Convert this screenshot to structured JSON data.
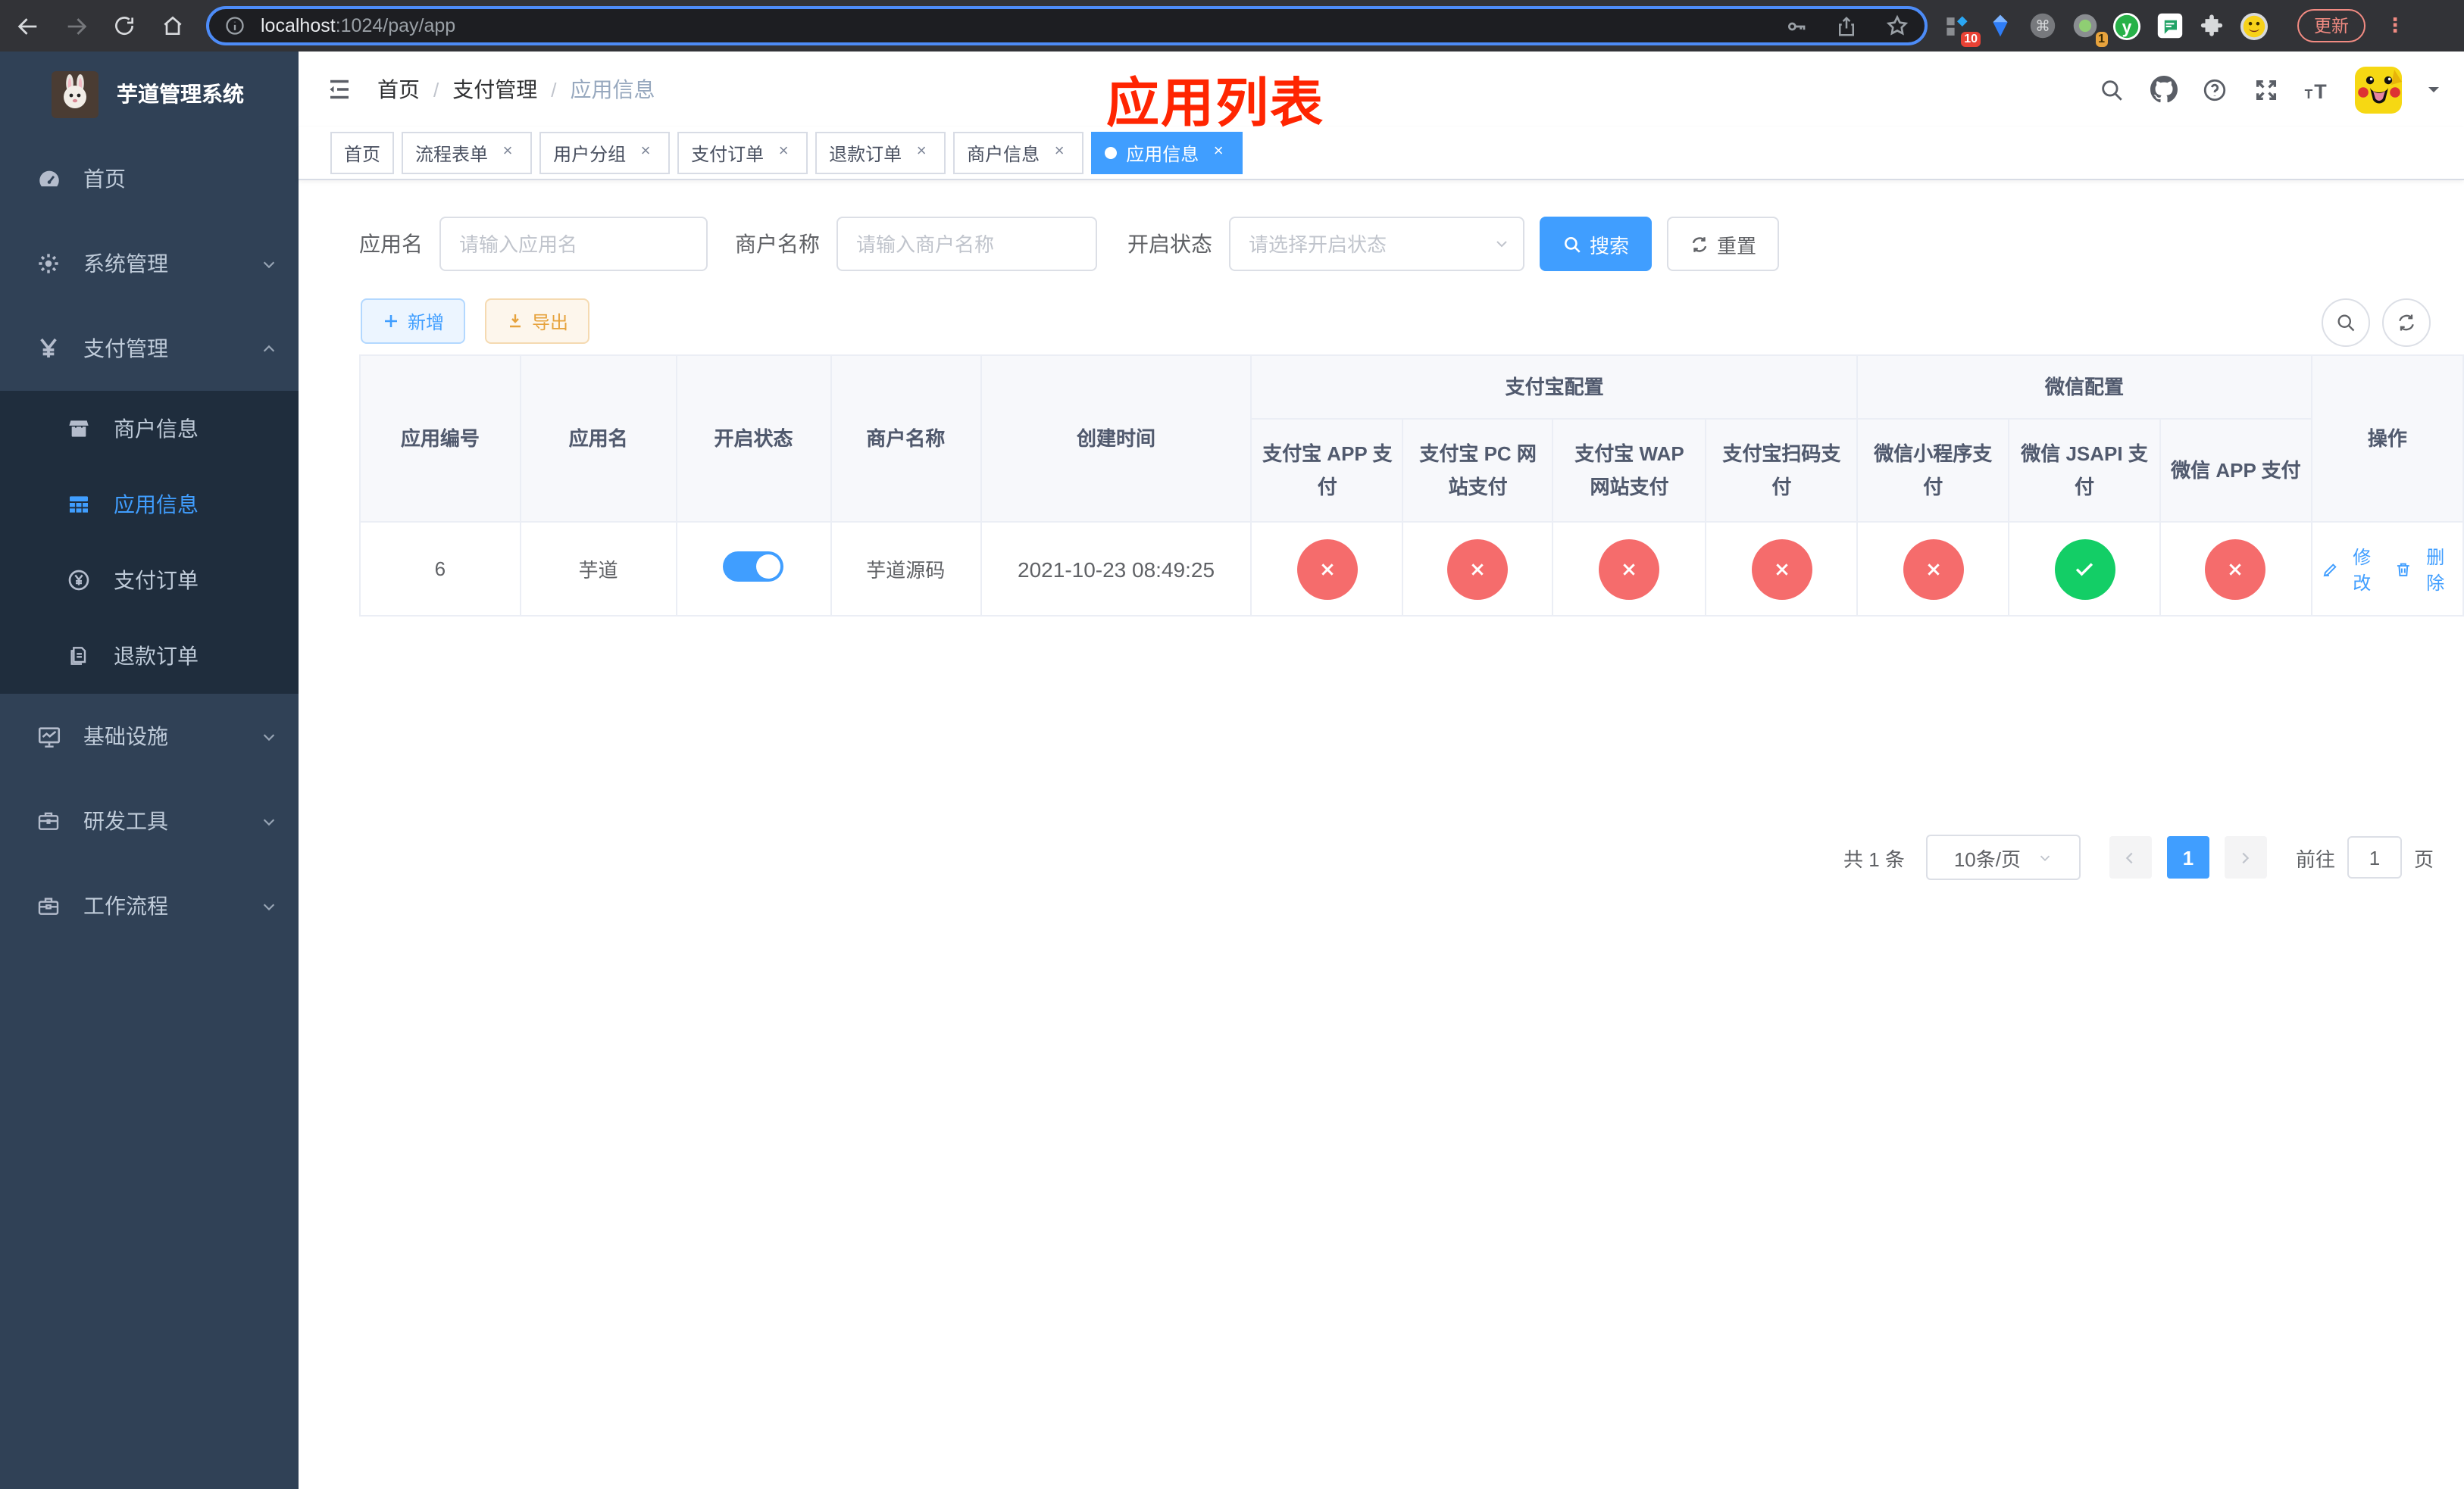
{
  "browser": {
    "url_host": "localhost",
    "url_rest": ":1024/pay/app",
    "update_label": "更新",
    "menu_dots": "⋮",
    "ext_badge_10": "10",
    "ext_badge_1": "1"
  },
  "sidebar": {
    "title": "芋道管理系统",
    "items": [
      {
        "label": "首页",
        "icon": "dashboard-icon",
        "children": null,
        "expanded": false,
        "active": false
      },
      {
        "label": "系统管理",
        "icon": "gear-icon",
        "children": [],
        "expanded": false,
        "active": false
      },
      {
        "label": "支付管理",
        "icon": "yen-icon",
        "expanded": true,
        "active": false,
        "children": [
          {
            "label": "商户信息",
            "icon": "shop-icon",
            "active": false
          },
          {
            "label": "应用信息",
            "icon": "grid-icon",
            "active": true
          },
          {
            "label": "支付订单",
            "icon": "yen-circle-icon",
            "active": false
          },
          {
            "label": "退款订单",
            "icon": "document-icon",
            "active": false
          }
        ]
      },
      {
        "label": "基础设施",
        "icon": "monitor-icon",
        "children": [],
        "expanded": false,
        "active": false
      },
      {
        "label": "研发工具",
        "icon": "briefcase-icon",
        "children": [],
        "expanded": false,
        "active": false
      },
      {
        "label": "工作流程",
        "icon": "toolbox-icon",
        "children": [],
        "expanded": false,
        "active": false
      }
    ]
  },
  "navbar": {
    "breadcrumb": [
      "首页",
      "支付管理",
      "应用信息"
    ],
    "annotation": "应用列表"
  },
  "tabs": [
    {
      "label": "首页",
      "closable": false,
      "active": false
    },
    {
      "label": "流程表单",
      "closable": true,
      "active": false
    },
    {
      "label": "用户分组",
      "closable": true,
      "active": false
    },
    {
      "label": "支付订单",
      "closable": true,
      "active": false
    },
    {
      "label": "退款订单",
      "closable": true,
      "active": false
    },
    {
      "label": "商户信息",
      "closable": true,
      "active": false
    },
    {
      "label": "应用信息",
      "closable": true,
      "active": true
    }
  ],
  "filters": {
    "app_name_label": "应用名",
    "app_name_placeholder": "请输入应用名",
    "merchant_label": "商户名称",
    "merchant_placeholder": "请输入商户名称",
    "status_label": "开启状态",
    "status_placeholder": "请选择开启状态",
    "search_label": "搜索",
    "reset_label": "重置"
  },
  "toolbar": {
    "add_label": "新增",
    "export_label": "导出"
  },
  "table": {
    "group_alipay": "支付宝配置",
    "group_wechat": "微信配置",
    "columns": [
      "应用编号",
      "应用名",
      "开启状态",
      "商户名称",
      "创建时间"
    ],
    "channel_columns": [
      "支付宝 APP 支付",
      "支付宝 PC 网站支付",
      "支付宝 WAP 网站支付",
      "支付宝扫码支付",
      "微信小程序支付",
      "微信 JSAPI 支付",
      "微信 APP 支付"
    ],
    "ops_label": "操作",
    "row": {
      "id": "6",
      "name": "芋道",
      "enabled": true,
      "merchant": "芋道源码",
      "created": "2021-10-23 08:49:25",
      "channels": [
        false,
        false,
        false,
        false,
        false,
        true,
        false
      ],
      "edit_label": "修改",
      "delete_label": "删除"
    }
  },
  "pagination": {
    "total": "共 1 条",
    "page_size": "10条/页",
    "current": "1",
    "goto_label": "前往",
    "goto_value": "1",
    "page_suffix": "页"
  },
  "colors": {
    "accent": "#409eff",
    "success": "#13ce66",
    "danger": "#f56c6c",
    "warning": "#e6a23c",
    "annotation_red": "#ff2501",
    "sidebar_bg": "#304156",
    "submenu_bg": "#1f2d3d"
  }
}
